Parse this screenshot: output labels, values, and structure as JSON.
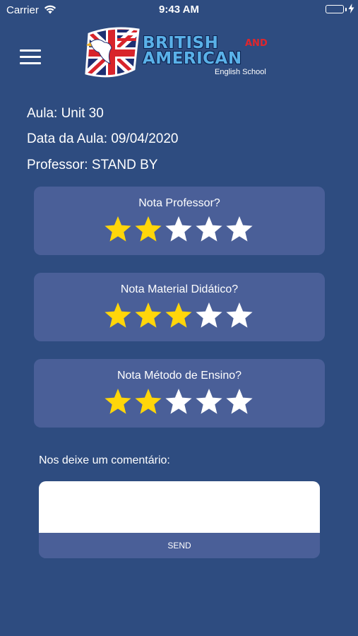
{
  "status_bar": {
    "carrier": "Carrier",
    "time": "9:43 AM",
    "battery_color": "#4cd964"
  },
  "logo": {
    "line1": "BRITISH",
    "and": "AND",
    "line2": "AMERICAN",
    "subtitle": "English School"
  },
  "lesson": {
    "aula": "Aula: Unit 30",
    "data": "Data da Aula: 09/04/2020",
    "professor": "Professor: STAND BY"
  },
  "ratings": [
    {
      "title": "Nota Professor?",
      "value": 2,
      "max": 5
    },
    {
      "title": "Nota Material Didático?",
      "value": 3,
      "max": 5
    },
    {
      "title": "Nota Método de Ensino?",
      "value": 2,
      "max": 5
    }
  ],
  "comment": {
    "label": "Nos deixe um comentário:",
    "value": "",
    "send_label": "SEND"
  },
  "colors": {
    "background": "#2e4c80",
    "card": "#4a5f98",
    "star_filled": "#ffd60a",
    "star_empty": "#ffffff"
  }
}
